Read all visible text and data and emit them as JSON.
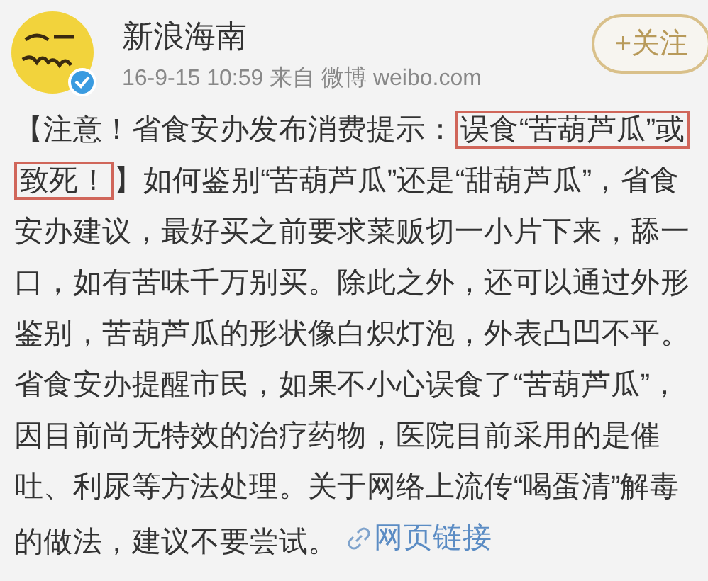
{
  "account": {
    "name": "新浪海南",
    "verified": true
  },
  "meta": {
    "time": "16-9-15 10:59",
    "source": "来自 微博 weibo.com"
  },
  "follow_button": {
    "label": "+关注"
  },
  "post": {
    "text_before": "【注意！省食安办发布消费提示：",
    "highlight": "误食“苦葫芦瓜”或致死！",
    "text_after": "】如何鉴别“苦葫芦瓜”还是“甜葫芦瓜”，省食安办建议，最好买之前要求菜贩切一小片下来，舔一口，如有苦味千万别买。除此之外，还可以通过外形鉴别，苦葫芦瓜的形状像白炽灯泡，外表凸凹不平。省食安办提醒市民，如果不小心误食了“苦葫芦瓜”，因目前尚无特效的治疗药物，医院目前采用的是催吐、利尿等方法处理。关于网络上流传“喝蛋清”解毒的做法，建议不要尝试。",
    "link": {
      "label": "网页链接"
    }
  }
}
